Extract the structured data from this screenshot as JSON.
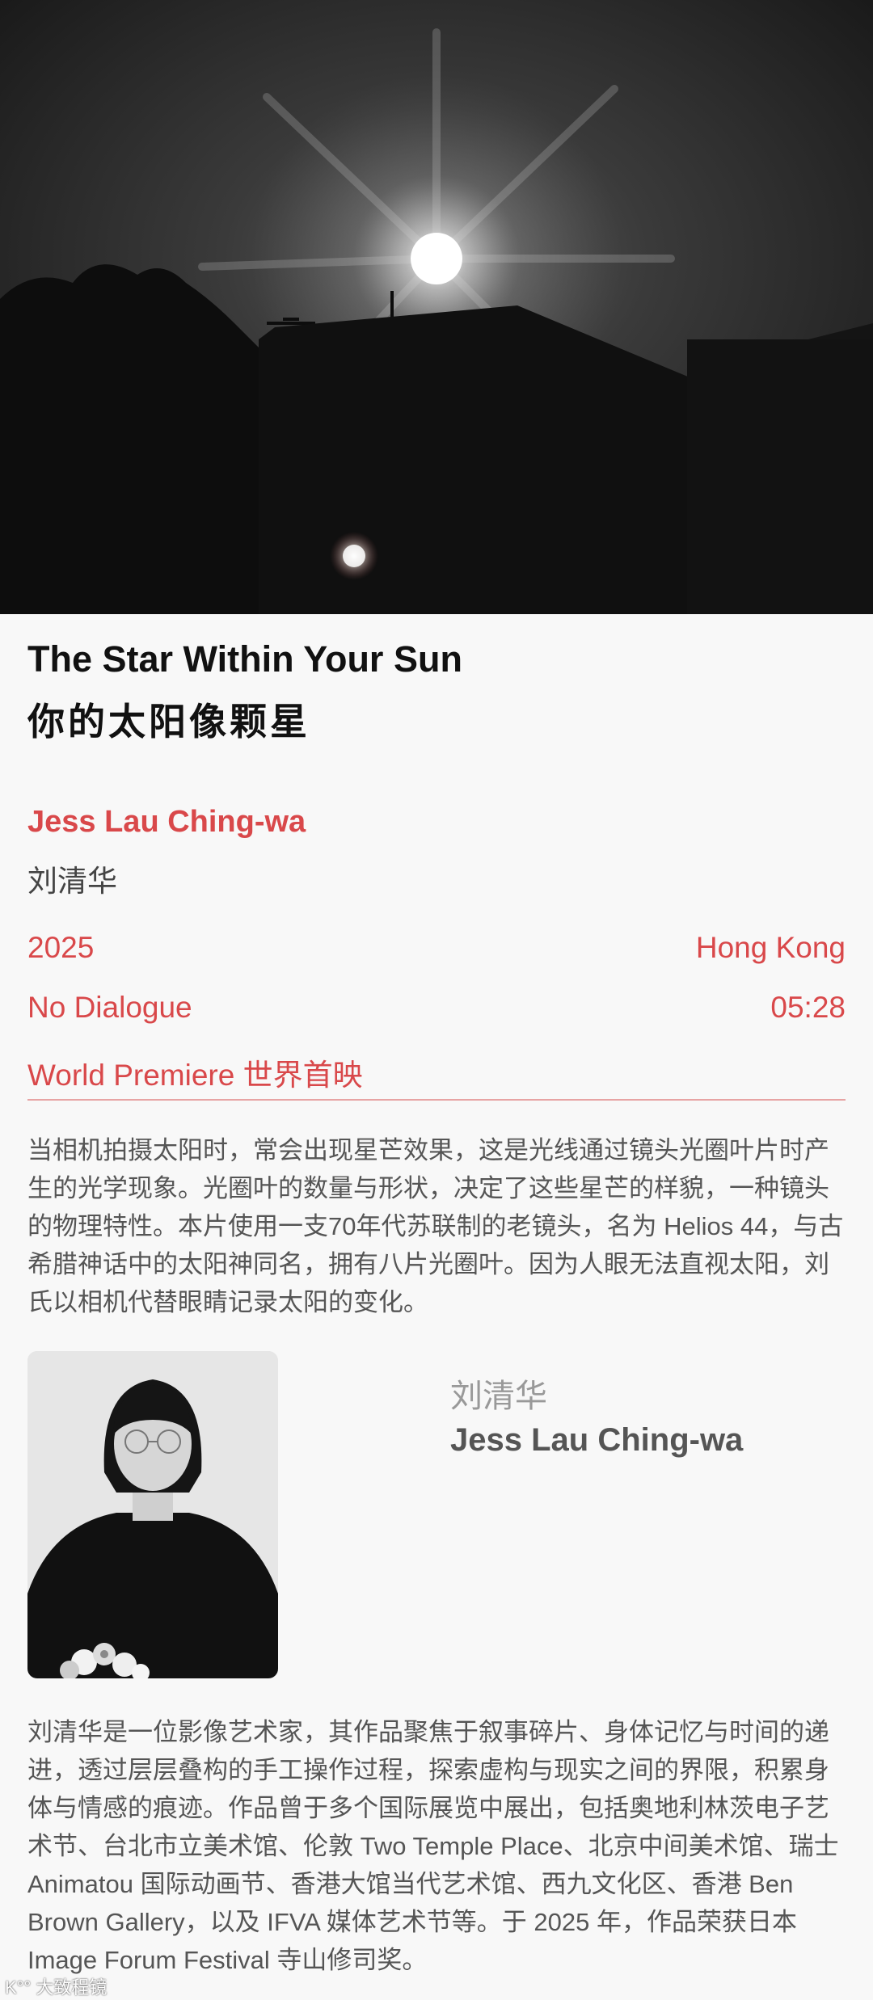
{
  "film": {
    "title_en": "The Star Within Your Sun",
    "title_zh": "你的太阳像颗星",
    "director_en": "Jess Lau Ching-wa",
    "director_zh": "刘清华",
    "year": "2025",
    "location": "Hong Kong",
    "dialogue": "No Dialogue",
    "duration": "05:28",
    "premiere": "World Premiere 世界首映",
    "synopsis": "当相机拍摄太阳时，常会出现星芒效果，这是光线通过镜头光圈叶片时产生的光学现象。光圈叶的数量与形状，决定了这些星芒的样貌，一种镜头的物理特性。本片使用一支70年代苏联制的老镜头，名为 Helios 44，与古希腊神话中的太阳神同名，拥有八片光圈叶。因为人眼无法直视太阳，刘氏以相机代替眼睛记录太阳的变化。"
  },
  "director_profile": {
    "name_zh": "刘清华",
    "name_en": "Jess Lau Ching-wa",
    "bio": "刘清华是一位影像艺术家，其作品聚焦于叙事碎片、身体记忆与时间的递进，透过层层叠构的手工操作过程，探索虚构与现实之间的界限，积累身体与情感的痕迹。作品曾于多个国际展览中展出，包括奥地利林茨电子艺术节、台北市立美术馆、伦敦 Two Temple Place、北京中间美术馆、瑞士 Animatou 国际动画节、香港大馆当代艺术馆、西九文化区、香港 Ben Brown Gallery，以及 IFVA 媒体艺术节等。于 2025 年，作品荣获日本 Image Forum Festival 寺山修司奖。"
  },
  "watermark": "K°° 大致程镜",
  "colors": {
    "accent": "#d9484a",
    "background": "#f8f8f8",
    "text_primary": "#111111",
    "text_secondary": "#555555"
  }
}
